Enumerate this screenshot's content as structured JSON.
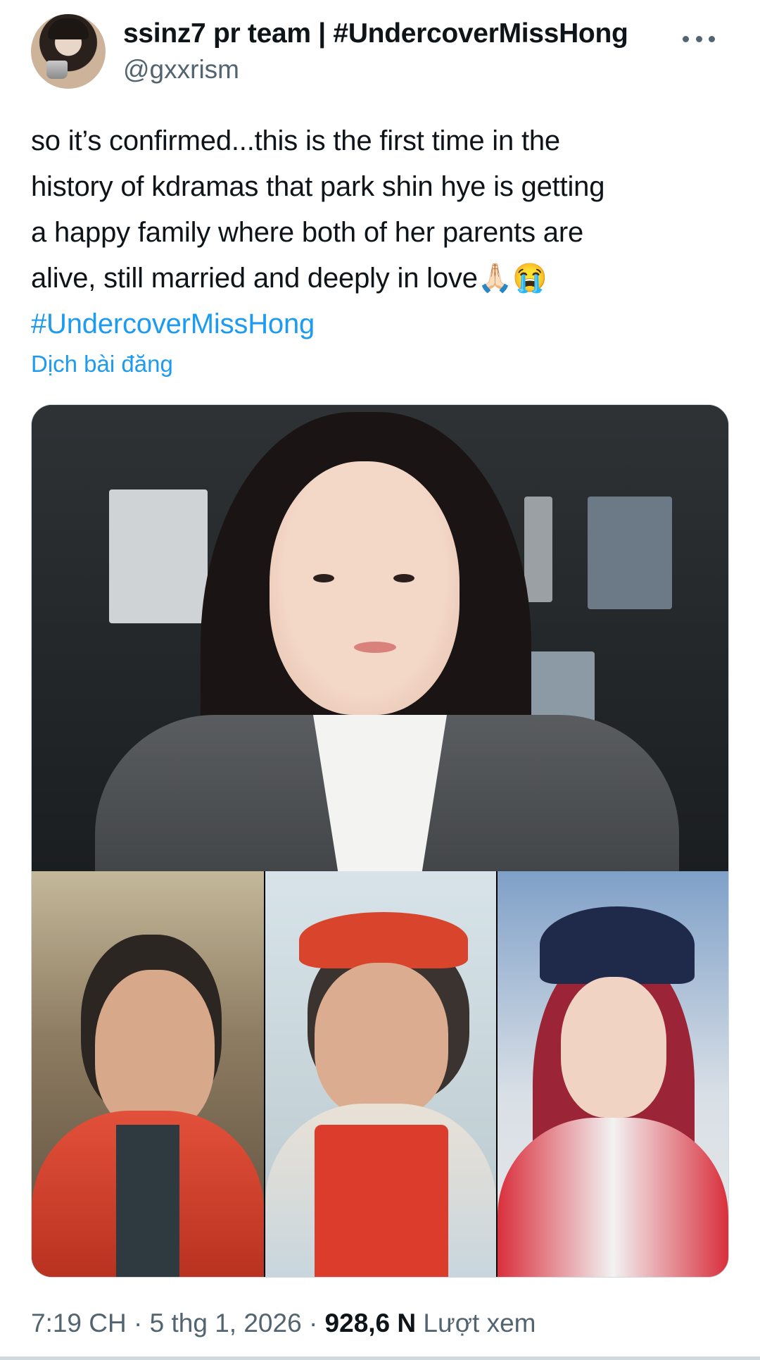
{
  "author": {
    "display_name": "ssinz7 pr team | #UndercoverMissHong",
    "handle": "@gxxrism"
  },
  "tweet": {
    "lines": [
      "so it’s confirmed...this is the first time in the",
      "history of kdramas that park shin hye is getting",
      "a happy family where both of her parents are",
      "alive, still married and deeply in love"
    ],
    "emojis": "🙏🏻😭",
    "hashtag": "#UndercoverMissHong",
    "translate_label": "Dịch bài đăng"
  },
  "media": {
    "photo_count": 4
  },
  "meta": {
    "time": "7:19 CH",
    "date": "5 thg 1, 2026",
    "views_count": "928,6 N",
    "views_label": "Lượt xem",
    "separator": "·"
  },
  "icons": {
    "more": "more-horizontal-icon"
  },
  "colors": {
    "link": "#1d9bf0",
    "secondary_text": "#536471",
    "primary_text": "#0f1419"
  }
}
